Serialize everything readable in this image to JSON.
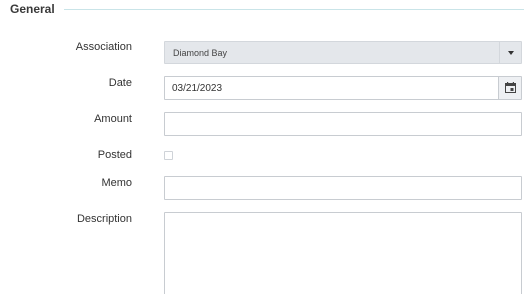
{
  "section": {
    "title": "General"
  },
  "fields": {
    "association": {
      "label": "Association",
      "value": "Diamond Bay"
    },
    "date": {
      "label": "Date",
      "value": "03/21/2023"
    },
    "amount": {
      "label": "Amount",
      "value": ""
    },
    "posted": {
      "label": "Posted",
      "checked": false
    },
    "memo": {
      "label": "Memo",
      "value": ""
    },
    "description": {
      "label": "Description",
      "value": ""
    }
  },
  "icons": {
    "select_arrow": "caret-down-icon",
    "calendar": "calendar-icon"
  },
  "colors": {
    "section_line": "#c9e4e8",
    "disabled_field": "#e4e7eb",
    "border": "#c8ccd1"
  }
}
